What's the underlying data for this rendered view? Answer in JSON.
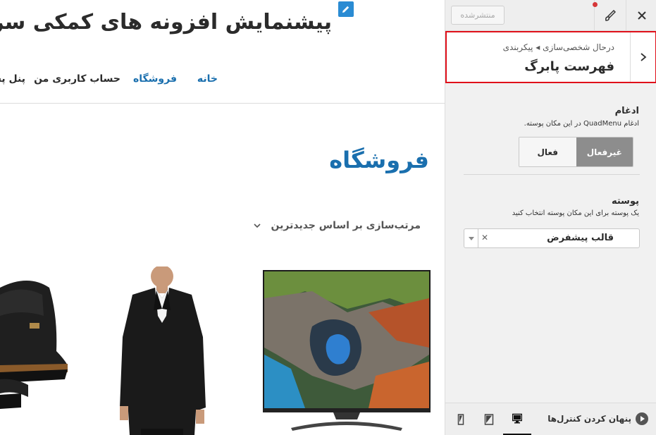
{
  "site": {
    "title": "پیشنمایش افزونه های کمکی سری",
    "nav": {
      "home": "خانه",
      "shop": "فروشگاه",
      "account": "حساب کاربری من",
      "panel": "پنل پش"
    }
  },
  "page": {
    "heading": "فروشگاه",
    "sort_label": "مرتب‌سازی بر اساس جدیدترین"
  },
  "products": [
    {
      "name": "tv",
      "icon": "tv-product-image"
    },
    {
      "name": "suit",
      "icon": "suit-product-image"
    },
    {
      "name": "shoes",
      "icon": "shoes-product-image"
    }
  ],
  "customizer": {
    "publish_label": "منتشرشده",
    "close_icon": "close-icon",
    "brush_icon": "brush-icon",
    "breadcrumb": "درحال شخصی‌سازی ◂ پیکربندی",
    "section_title": "فهرست پابرگ",
    "merge": {
      "title": "ادغام",
      "description": "ادغام QuadMenu در این مکان پوسته.",
      "options": [
        "غیرفعال",
        "فعال"
      ],
      "selected": "غیرفعال"
    },
    "skin": {
      "title": "پوسته",
      "description": "یک پوسته برای این مکان پوسته انتخاب کنید",
      "value": "قالب پیشفرض"
    },
    "footer": {
      "collapse_label": "پنهان کردن کنترل‌ها",
      "devices": [
        "desktop",
        "tablet",
        "mobile"
      ],
      "active_device": "desktop"
    }
  },
  "colors": {
    "accent_blue": "#1a6fae",
    "highlight_red": "#e0101a",
    "toggle_active": "#8d8d8d"
  }
}
